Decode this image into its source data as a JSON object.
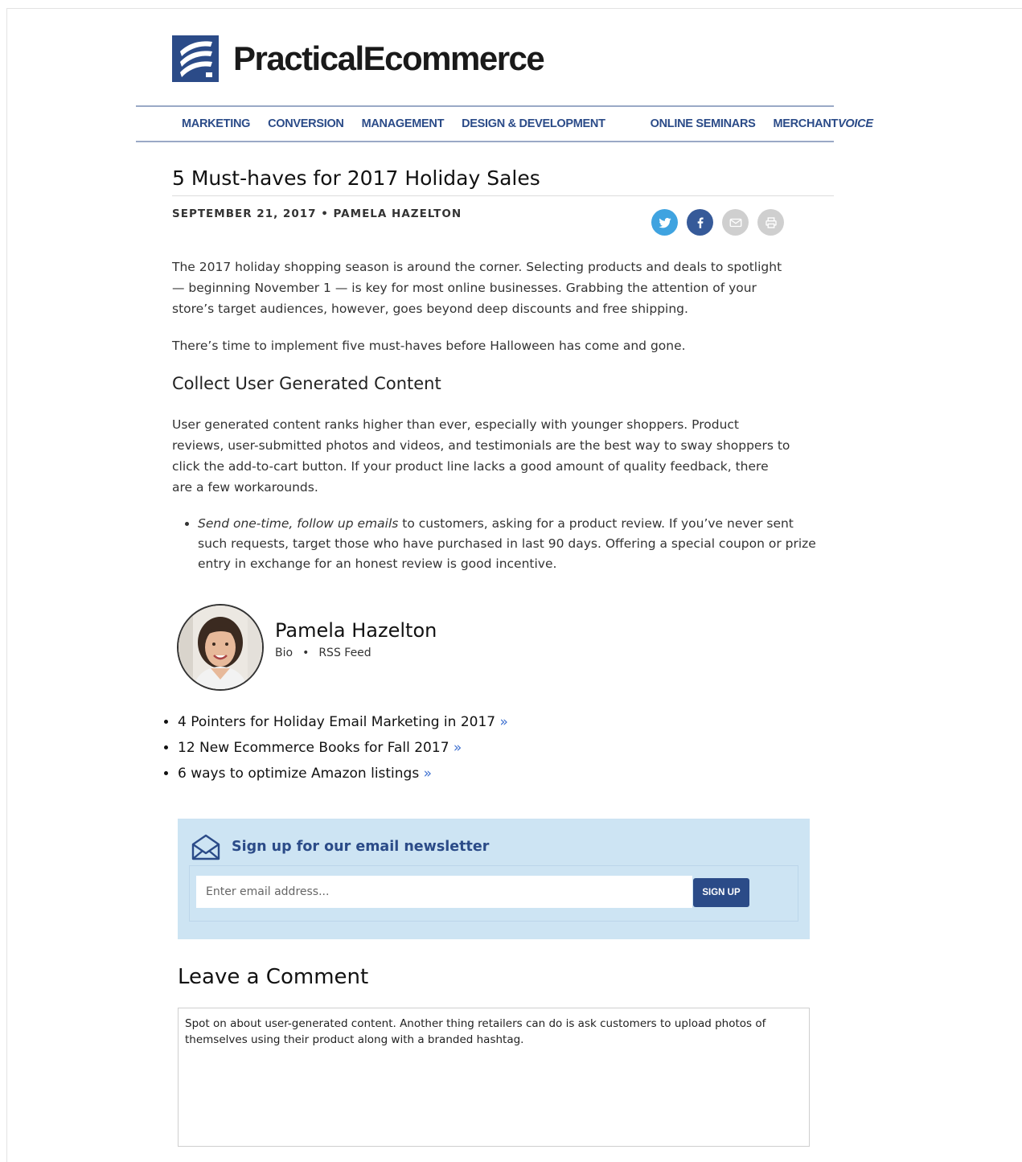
{
  "brand": {
    "name": "PracticalEcommerce",
    "color": "#2b4b88"
  },
  "nav": {
    "left": [
      "MARKETING",
      "CONVERSION",
      "MANAGEMENT",
      "DESIGN & DEVELOPMENT"
    ],
    "seminars": "ONLINE SEMINARS",
    "merchant": "MERCHANT",
    "voice": "VOICE"
  },
  "article": {
    "title": "5 Must-haves for 2017 Holiday Sales",
    "meta": "SEPTEMBER 21, 2017 • PAMELA HAZELTON",
    "share_icons": [
      "twitter-icon",
      "facebook-icon",
      "email-icon",
      "print-icon"
    ],
    "p1": "The 2017 holiday shopping season is around the corner. Selecting products and deals to spotlight — beginning November 1 — is key for most online businesses. Grabbing the attention of your store’s target audiences, however, goes beyond deep discounts and free shipping.",
    "p2": "There’s time to implement five must-haves before Halloween has come and gone.",
    "h2": "Collect User Generated Content",
    "p3": "User generated content ranks higher than ever, especially with younger shoppers. Product reviews, user-submitted photos and videos, and testimonials are the best way to sway shoppers to click the add-to-cart button. If your product line lacks a good amount of quality feedback, there are a few workarounds.",
    "bullet_em": "Send one-time, follow up emails",
    "bullet_rest": " to customers, asking for a product review. If you’ve never sent such requests, target those who have purchased in last 90 days. Offering a special coupon or prize entry in exchange for an honest review is good incentive."
  },
  "author": {
    "name": "Pamela Hazelton",
    "bio": "Bio",
    "rss": "RSS Feed",
    "sep": "•"
  },
  "related": [
    {
      "title": "4 Pointers for Holiday Email Marketing in 2017",
      "arrow": "»"
    },
    {
      "title": "12 New Ecommerce Books for Fall 2017",
      "arrow": "»"
    },
    {
      "title": "6 ways to optimize Amazon listings",
      "arrow": "»"
    }
  ],
  "newsletter": {
    "title": "Sign up for our email newsletter",
    "placeholder": "Enter email address...",
    "button": "SIGN UP"
  },
  "comment": {
    "title": "Leave a Comment",
    "text": "Spot on about user-generated content. Another thing retailers can do is ask customers to upload photos of themselves using their product along with a branded hashtag."
  }
}
